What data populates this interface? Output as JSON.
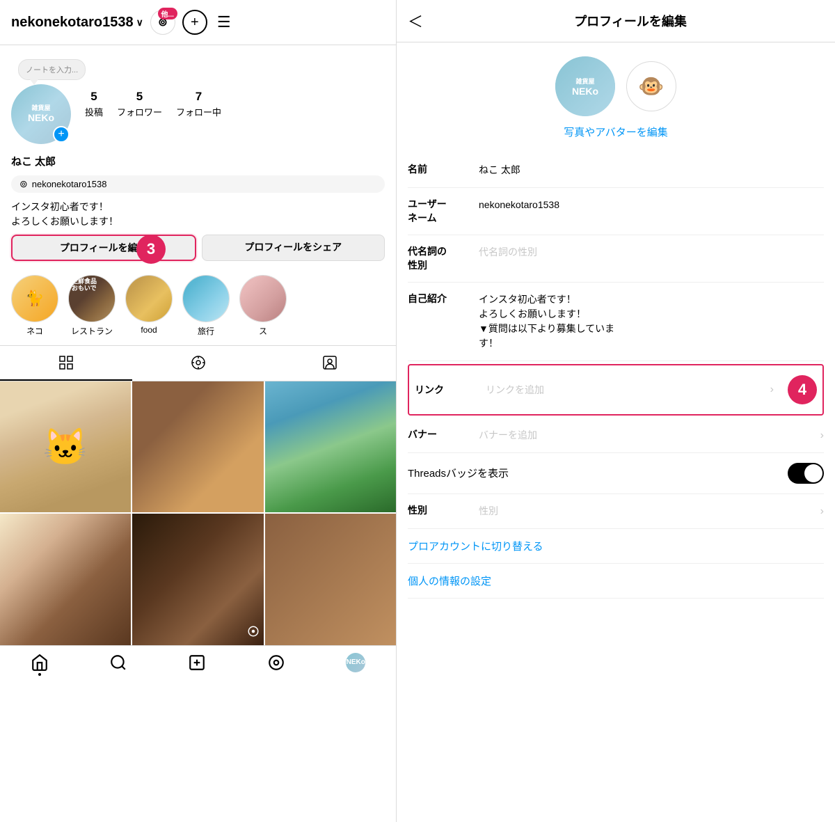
{
  "left": {
    "username": "nekonekotaro1538",
    "chevron": "∨",
    "note_placeholder": "ノートを入力...",
    "stats": [
      {
        "number": "5",
        "label": "投稿"
      },
      {
        "number": "5",
        "label": "フォロワー"
      },
      {
        "number": "7",
        "label": "フォロー中"
      }
    ],
    "display_name": "ねこ 太郎",
    "threads_handle": "nekonekotaro1538",
    "bio": "インスタ初心者です！\nよろしくお願いします！",
    "buttons": {
      "edit": "プロフィールを編集",
      "share": "プロフィールをシェア"
    },
    "step3_label": "3",
    "highlights": [
      {
        "label": "ネコ",
        "class": "cat"
      },
      {
        "label": "レストラン",
        "class": "restaurant"
      },
      {
        "label": "food",
        "class": "food"
      },
      {
        "label": "旅行",
        "class": "travel"
      },
      {
        "label": "ス",
        "class": "more"
      }
    ],
    "tabs": [
      {
        "icon": "⊞",
        "active": true
      },
      {
        "icon": "▶",
        "active": false
      },
      {
        "icon": "👤",
        "active": false
      }
    ],
    "bottom_nav": [
      {
        "icon": "🏠",
        "label": "home",
        "active": true
      },
      {
        "icon": "🔍",
        "label": "search",
        "active": false
      },
      {
        "icon": "➕",
        "label": "add",
        "active": false
      },
      {
        "icon": "▶",
        "label": "reels",
        "active": false
      },
      {
        "icon": "👤",
        "label": "profile",
        "active": false
      }
    ]
  },
  "right": {
    "back_arrow": "＜",
    "page_title": "プロフィールを編集",
    "edit_photo_label": "写真やアバターを編集",
    "avatar_emoji": "🐵",
    "form_rows": [
      {
        "label": "名前",
        "value": "ねこ 太郎",
        "placeholder": false,
        "has_chevron": false,
        "highlighted": false
      },
      {
        "label": "ユーザー\nネーム",
        "value": "nekonekotaro1538",
        "placeholder": false,
        "has_chevron": false,
        "highlighted": false
      },
      {
        "label": "代名詞の\n性別",
        "value": "代名詞の性別",
        "placeholder": true,
        "has_chevron": false,
        "highlighted": false
      },
      {
        "label": "自己紹介",
        "value": "インスタ初心者です！\nよろしくお願いします！\n▼質問は以下より募集していま\nす！",
        "placeholder": false,
        "has_chevron": false,
        "highlighted": false
      },
      {
        "label": "リンク",
        "value": "リンクを追加",
        "placeholder": true,
        "has_chevron": true,
        "highlighted": true
      },
      {
        "label": "バナー",
        "value": "バナーを追加",
        "placeholder": true,
        "has_chevron": true,
        "highlighted": false
      }
    ],
    "threads_badge_label": "Threadsバッジを表示",
    "gender_label": "性別",
    "gender_value": "性別",
    "pro_account_link": "プロアカウントに切り替える",
    "personal_info_link": "個人の情報の設定",
    "step4_label": "4"
  }
}
